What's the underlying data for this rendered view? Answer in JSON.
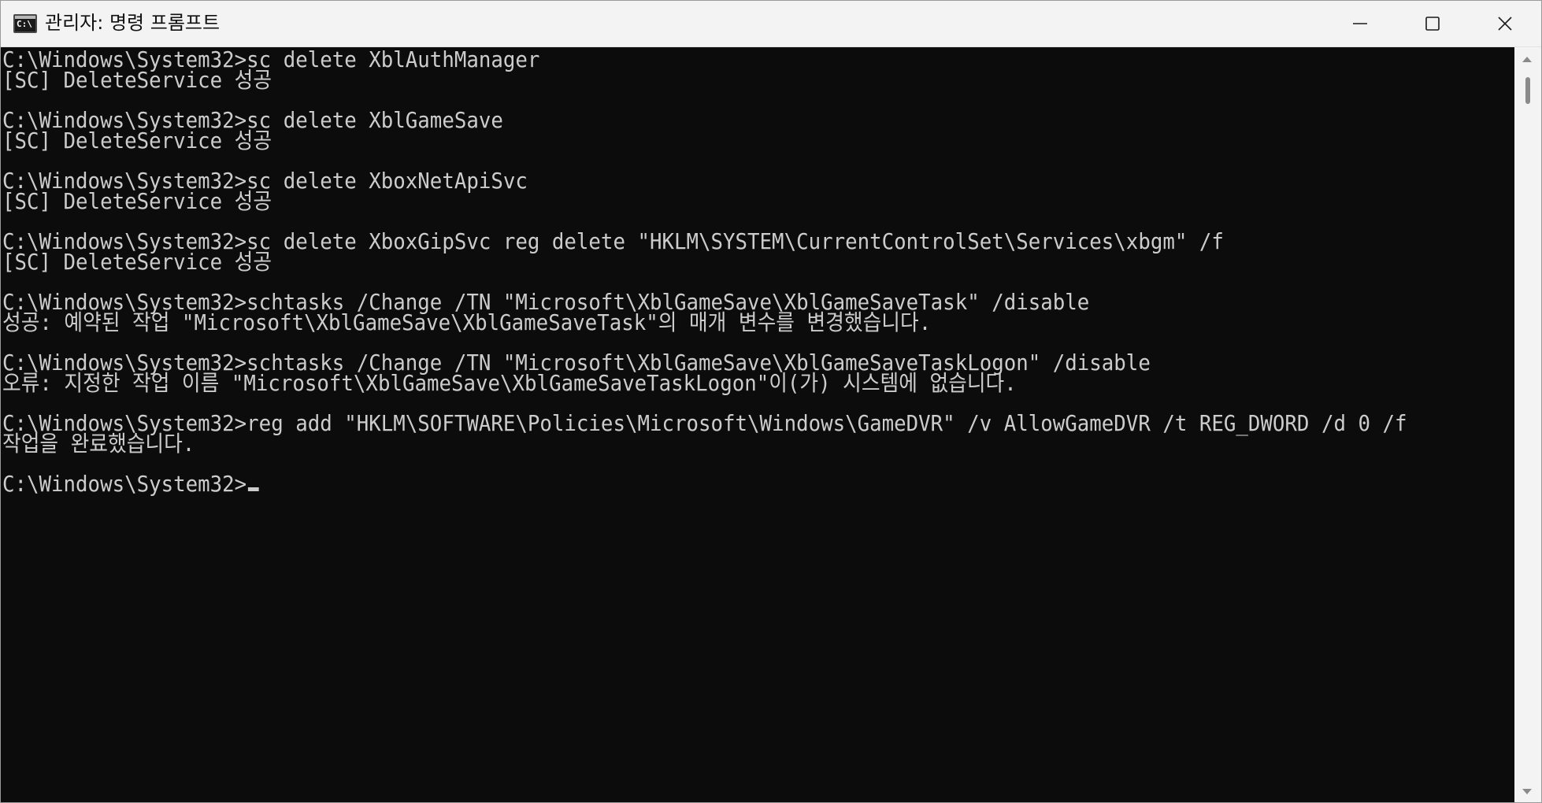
{
  "window": {
    "title": "관리자: 명령 프롬프트",
    "icon": "cmd-icon",
    "icon_glyph": "C:\\",
    "controls": [
      "minimize-icon",
      "maximize-icon",
      "close-icon"
    ]
  },
  "console": {
    "lines": [
      "C:\\Windows\\System32>sc delete XblAuthManager",
      "[SC] DeleteService 성공",
      "",
      "C:\\Windows\\System32>sc delete XblGameSave",
      "[SC] DeleteService 성공",
      "",
      "C:\\Windows\\System32>sc delete XboxNetApiSvc",
      "[SC] DeleteService 성공",
      "",
      "C:\\Windows\\System32>sc delete XboxGipSvc reg delete \"HKLM\\SYSTEM\\CurrentControlSet\\Services\\xbgm\" /f",
      "[SC] DeleteService 성공",
      "",
      "C:\\Windows\\System32>schtasks /Change /TN \"Microsoft\\XblGameSave\\XblGameSaveTask\" /disable",
      "성공: 예약된 작업 \"Microsoft\\XblGameSave\\XblGameSaveTask\"의 매개 변수를 변경했습니다.",
      "",
      "C:\\Windows\\System32>schtasks /Change /TN \"Microsoft\\XblGameSave\\XblGameSaveTaskLogon\" /disable",
      "오류: 지정한 작업 이름 \"Microsoft\\XblGameSave\\XblGameSaveTaskLogon\"이(가) 시스템에 없습니다.",
      "",
      "C:\\Windows\\System32>reg add \"HKLM\\SOFTWARE\\Policies\\Microsoft\\Windows\\GameDVR\" /v AllowGameDVR /t REG_DWORD /d 0 /f",
      "작업을 완료했습니다.",
      "",
      "C:\\Windows\\System32>"
    ]
  },
  "colors": {
    "console_bg": "#0c0c0c",
    "console_text": "#cccccc",
    "titlebar_bg": "#f3f3f3"
  }
}
